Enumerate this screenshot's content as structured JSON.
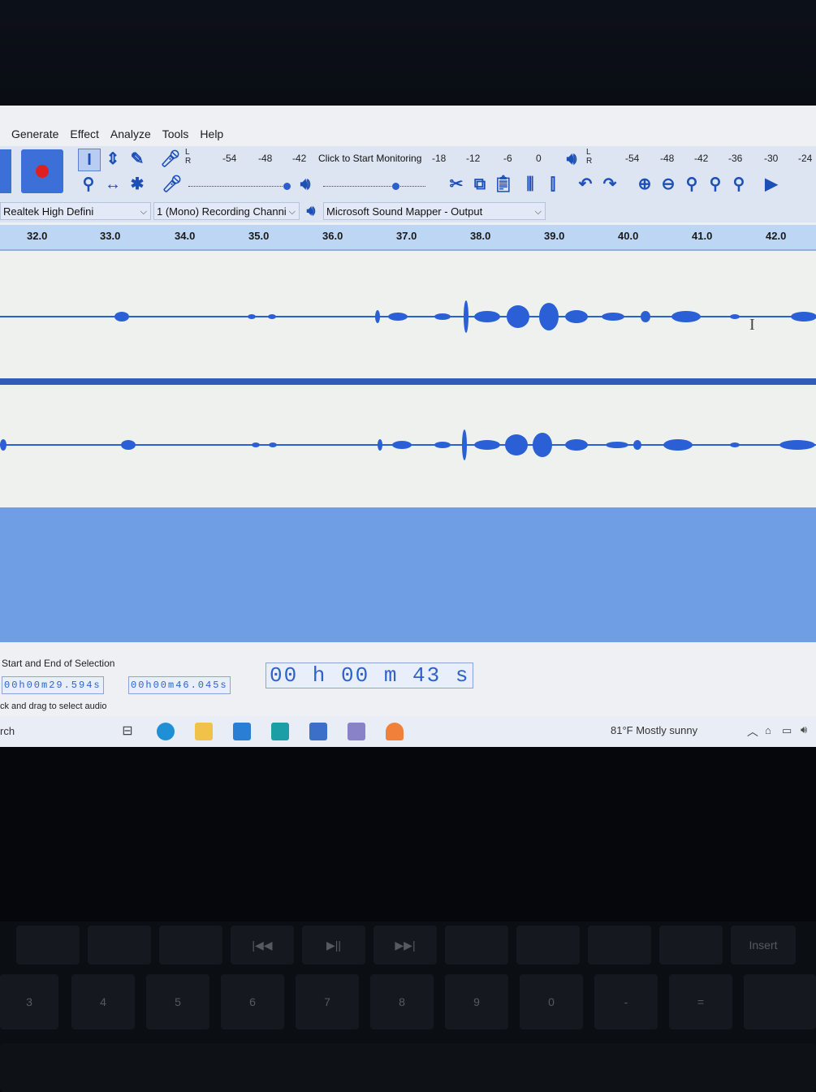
{
  "menu": [
    "Generate",
    "Effect",
    "Analyze",
    "Tools",
    "Help"
  ],
  "record_meter": {
    "channels": [
      "L",
      "R"
    ],
    "ticks": [
      "-54",
      "-48",
      "-42",
      "-18",
      "-12",
      "-6",
      "0"
    ],
    "monitor_label": "Click to Start Monitoring"
  },
  "playback_meter": {
    "channels": [
      "L",
      "R"
    ],
    "ticks": [
      "-54",
      "-48",
      "-42",
      "-36",
      "-30",
      "-24"
    ]
  },
  "devices": {
    "input_device": "Realtek High Defini",
    "channels": "1 (Mono) Recording Channi",
    "output_device": "Microsoft Sound Mapper - Output"
  },
  "timeline": [
    "32.0",
    "33.0",
    "34.0",
    "35.0",
    "36.0",
    "37.0",
    "38.0",
    "39.0",
    "40.0",
    "41.0",
    "42.0"
  ],
  "selection": {
    "label": "Start and End of Selection",
    "start": "00h00m29.594s",
    "end": "00h00m46.045s",
    "position": "00 h 00 m 43 s"
  },
  "status_text": "ck and drag to select audio",
  "taskbar": {
    "search_stub": "rch",
    "weather": "81°F  Mostly sunny"
  },
  "keyboard_row1": [
    "",
    "",
    "",
    "|◀◀",
    "▶||",
    "▶▶|",
    "",
    "",
    "",
    "",
    "Insert"
  ],
  "keyboard_row2": [
    "3",
    "4",
    "5",
    "6",
    "7",
    "8",
    "9",
    "0",
    "-",
    "=",
    ""
  ],
  "colors": {
    "waveform": "#2a5fd6",
    "selection": "#6f9ee4",
    "accent": "#2f62c9"
  }
}
